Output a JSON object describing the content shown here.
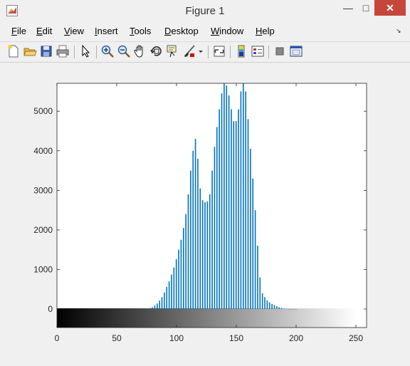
{
  "window": {
    "title": "Figure 1",
    "minimize": "—",
    "maximize": "□",
    "close": "✕"
  },
  "menu": [
    {
      "label": "File",
      "u": "F",
      "rest": "ile"
    },
    {
      "label": "Edit",
      "u": "E",
      "rest": "dit"
    },
    {
      "label": "View",
      "u": "V",
      "rest": "iew"
    },
    {
      "label": "Insert",
      "u": "I",
      "rest": "nsert"
    },
    {
      "label": "Tools",
      "u": "T",
      "rest": "ools"
    },
    {
      "label": "Desktop",
      "u": "D",
      "rest": "esktop"
    },
    {
      "label": "Window",
      "u": "W",
      "rest": "indow"
    },
    {
      "label": "Help",
      "u": "H",
      "rest": "elp"
    }
  ],
  "toolbar": [
    "new-figure-icon",
    "open-file-icon",
    "save-icon",
    "print-icon",
    "pointer-arrow-icon",
    "zoom-in-icon",
    "zoom-out-icon",
    "pan-hand-icon",
    "rotate-3d-icon",
    "data-cursor-icon",
    "brush-icon",
    "brush-dropdown-icon",
    "link-plot-icon",
    "colorbar-icon",
    "legend-icon",
    "hide-plot-tools-icon",
    "show-plot-tools-icon"
  ],
  "chart_data": {
    "type": "bar",
    "title": "",
    "xlabel": "",
    "ylabel": "",
    "xlim": [
      0,
      255
    ],
    "ylim": [
      0,
      5700
    ],
    "xticks": [
      "0",
      "50",
      "100",
      "150",
      "200",
      "250"
    ],
    "yticks": [
      "0",
      "1000",
      "2000",
      "3000",
      "4000",
      "5000"
    ],
    "bar_color": "#0072bd",
    "colorbar": "grayscale 0-255",
    "x": [
      76,
      78,
      80,
      82,
      84,
      86,
      88,
      90,
      92,
      94,
      96,
      98,
      100,
      102,
      104,
      106,
      108,
      110,
      112,
      114,
      116,
      118,
      120,
      122,
      124,
      126,
      128,
      130,
      132,
      134,
      136,
      138,
      140,
      142,
      144,
      146,
      148,
      150,
      152,
      154,
      156,
      158,
      160,
      162,
      164,
      166,
      168,
      170,
      172,
      174,
      176,
      178,
      180,
      182,
      184,
      186,
      188,
      190,
      192,
      194,
      196,
      198,
      200
    ],
    "values": [
      10,
      25,
      45,
      90,
      140,
      210,
      300,
      420,
      560,
      700,
      870,
      1050,
      1260,
      1500,
      1750,
      2050,
      2400,
      2900,
      3500,
      4000,
      4300,
      3800,
      3050,
      2750,
      2700,
      2720,
      2900,
      3500,
      4100,
      4600,
      5050,
      5450,
      5700,
      5650,
      5400,
      5050,
      4750,
      4750,
      5050,
      5500,
      5750,
      5500,
      4800,
      4050,
      3300,
      2500,
      1600,
      800,
      400,
      300,
      220,
      170,
      130,
      100,
      70,
      45,
      25,
      12,
      5,
      2,
      1,
      0,
      0
    ]
  }
}
